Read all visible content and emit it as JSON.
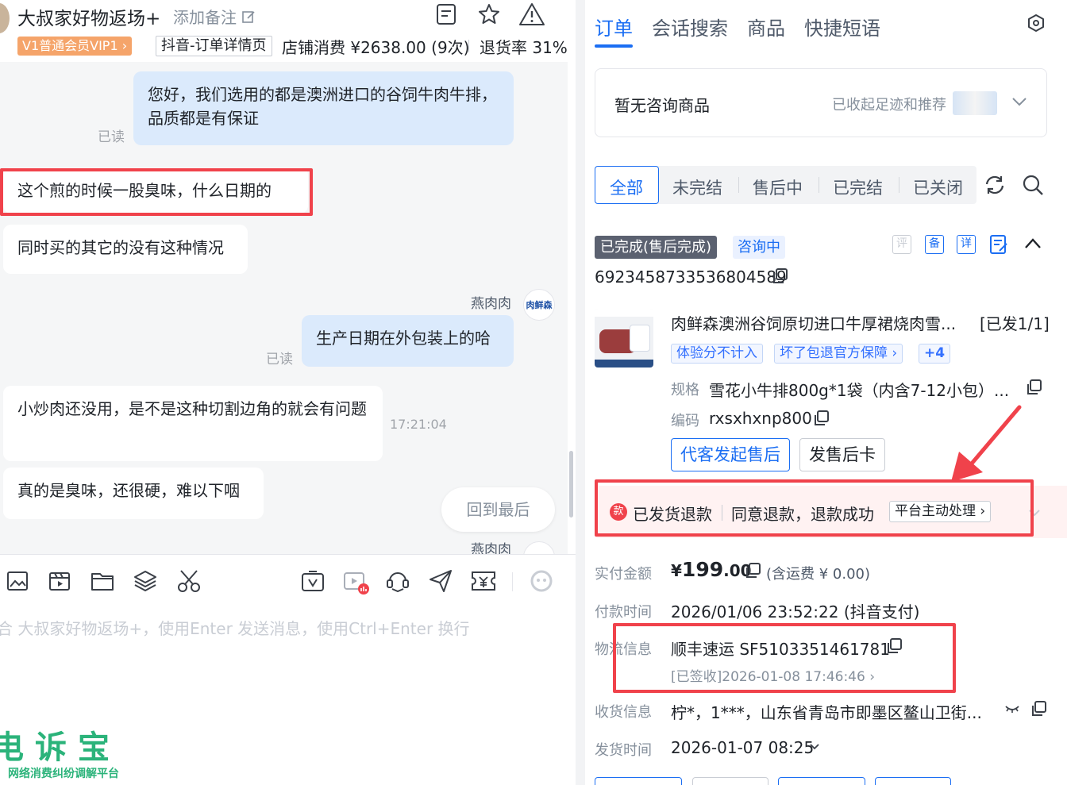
{
  "header": {
    "shop_name": "大叔家好物返场+",
    "add_note": "添加备注",
    "vip_badge": "V1普通会员VIP1 ›",
    "order_page_tag": "抖音-订单详情页",
    "store_spend": "店铺消费 ¥2638.00 (9次)",
    "return_rate": "退货率 31%"
  },
  "messages": {
    "m1": "您好，我们选用的都是澳洲进口的谷饲牛肉牛排，品质都是有保证",
    "m1_read": "已读",
    "m2": "这个煎的时候一股臭味，什么日期的",
    "m3": "同时买的其它的没有这种情况",
    "agent_name": "燕肉肉",
    "avatar_text": "肉鲜森",
    "m4": "生产日期在外包装上的哈",
    "m4_read": "已读",
    "m5": "小炒肉还没用，是不是这种切割边角的就会有问题",
    "m5_time": "17:21:04",
    "m6": "真的是臭味，还很硬，难以下咽",
    "back_to_last": "回到最后",
    "agent_name2": "燕肉肉"
  },
  "input": {
    "placeholder": "合 大叔家好物返场+，使用Enter 发送消息，使用Ctrl+Enter 换行"
  },
  "watermark": {
    "title": "电诉宝",
    "subtitle": "网络消费纠纷调解平台"
  },
  "right_tabs": [
    "订单",
    "会话搜索",
    "商品",
    "快捷短语"
  ],
  "consult": {
    "empty": "暂无咨询商品",
    "collapsed": "已收起足迹和推荐"
  },
  "filters": [
    "全部",
    "未完结",
    "售后中",
    "已完结",
    "已关闭"
  ],
  "order": {
    "status": "已完成(售后完成)",
    "consult_tag": "咨询中",
    "action_icons": [
      "评",
      "备",
      "详"
    ],
    "order_id": "6923458733536804589",
    "product_title": "肉鲜森澳洲谷饲原切进口牛厚裙烧肉雪...",
    "shipped": "[已发1/1]",
    "tags": [
      "体验分不计入",
      "坏了包退官方保障 ›",
      "+4"
    ],
    "spec_label": "规格",
    "spec_value": "雪花小牛排800g*1袋（内含7-12小包）...",
    "code_label": "编码",
    "code_value": "rxsxhxnp800",
    "btn_after_sale": "代客发起售后",
    "btn_card": "发售后卡",
    "refund_icon": "款",
    "refund_type": "已发货退款",
    "refund_result": "同意退款，退款成功",
    "refund_handler": "平台主动处理 ›",
    "paid_label": "实付金额",
    "paid_currency": "¥",
    "paid_int": "199",
    "paid_dec": ".00",
    "paid_note": "(含运费 ¥ 0.00)",
    "paytime_label": "付款时间",
    "paytime_value": "2026/01/06 23:52:22 (抖音支付)",
    "logistics_label": "物流信息",
    "logistics_value": "顺丰速运 SF5103351461781",
    "logistics_status": "[已签收]2026-01-08 17:46:46 ›",
    "receiver_label": "收货信息",
    "receiver_value": "柠*，1***，山东省青岛市即墨区鳌山卫街...",
    "ship_label": "发货时间",
    "ship_value": "2026-01-07 08:25"
  },
  "colors": {
    "accent": "#1b6ef3",
    "red_box": "#f0424b",
    "status_bg": "#5b6170"
  }
}
